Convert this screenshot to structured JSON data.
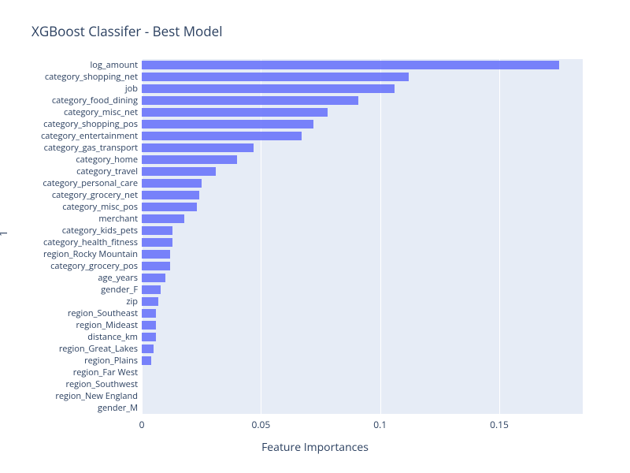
{
  "chart_data": {
    "type": "bar",
    "orientation": "horizontal",
    "title": "XGBoost Classifer - Best Model",
    "xlabel": "Feature Importances",
    "ylabel": "1",
    "xlim": [
      0,
      0.185
    ],
    "xticks": [
      0,
      0.05,
      0.1,
      0.15
    ],
    "categories": [
      "log_amount",
      "category_shopping_net",
      "job",
      "category_food_dining",
      "category_misc_net",
      "category_shopping_pos",
      "category_entertainment",
      "category_gas_transport",
      "category_home",
      "category_travel",
      "category_personal_care",
      "category_grocery_net",
      "category_misc_pos",
      "merchant",
      "category_kids_pets",
      "category_health_fitness",
      "region_Rocky Mountain",
      "category_grocery_pos",
      "age_years",
      "gender_F",
      "zip",
      "region_Southeast",
      "region_Mideast",
      "distance_km",
      "region_Great_Lakes",
      "region_Plains",
      "region_Far West",
      "region_Southwest",
      "region_New England",
      "gender_M"
    ],
    "values": [
      0.175,
      0.112,
      0.106,
      0.091,
      0.078,
      0.072,
      0.067,
      0.047,
      0.04,
      0.031,
      0.025,
      0.024,
      0.023,
      0.018,
      0.013,
      0.013,
      0.012,
      0.012,
      0.01,
      0.008,
      0.007,
      0.006,
      0.006,
      0.006,
      0.005,
      0.004,
      0.0,
      0.0,
      0.0,
      0.0
    ],
    "bar_color": "#636efa",
    "plot_bg": "#e6ecf6"
  }
}
